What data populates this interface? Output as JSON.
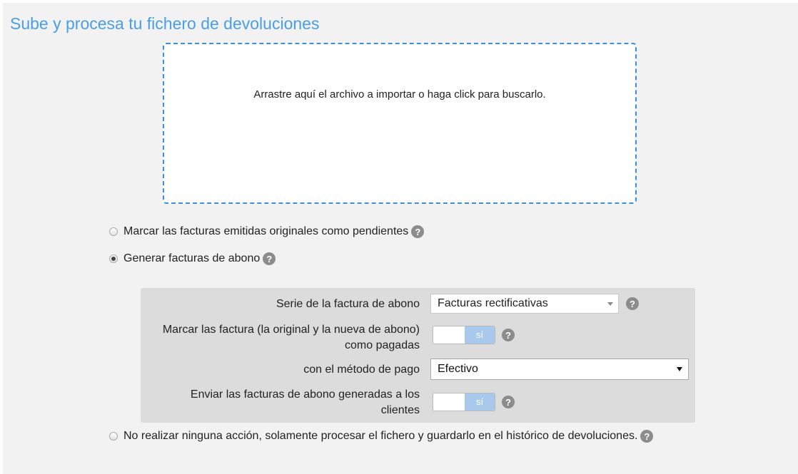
{
  "page": {
    "title": "Sube y procesa tu fichero de devoluciones"
  },
  "dropzone": {
    "text": "Arrastre aquí el archivo a importar o haga click para buscarlo."
  },
  "options": {
    "mark_pending": {
      "label": "Marcar las facturas emitidas originales como pendientes",
      "checked": false
    },
    "generate_credit": {
      "label": "Generar facturas de abono",
      "checked": true
    },
    "no_action": {
      "label": "No realizar ninguna acción, solamente procesar el fichero y guardarlo en el histórico de devoluciones.",
      "checked": false
    }
  },
  "credit_settings": {
    "serie_label": "Serie de la factura de abono",
    "serie_value": "Facturas rectificativas",
    "mark_paid_label_line1": "Marcar las factura (la original y la nueva de abono)",
    "mark_paid_label_line2": "como pagadas",
    "mark_paid_toggle": "sí",
    "payment_method_label": "con el método de pago",
    "payment_method_value": "Efectivo",
    "send_label_line1": "Enviar las facturas de abono generadas a los",
    "send_label_line2": "clientes",
    "send_toggle": "sí"
  },
  "help_icon": "?",
  "colors": {
    "title": "#4a9ee6",
    "dropzone_border": "#3c8fe0",
    "toggle_on": "#a8c9ec",
    "panel_bg": "#f2f2f2",
    "options_bg": "#dcdcdc"
  }
}
